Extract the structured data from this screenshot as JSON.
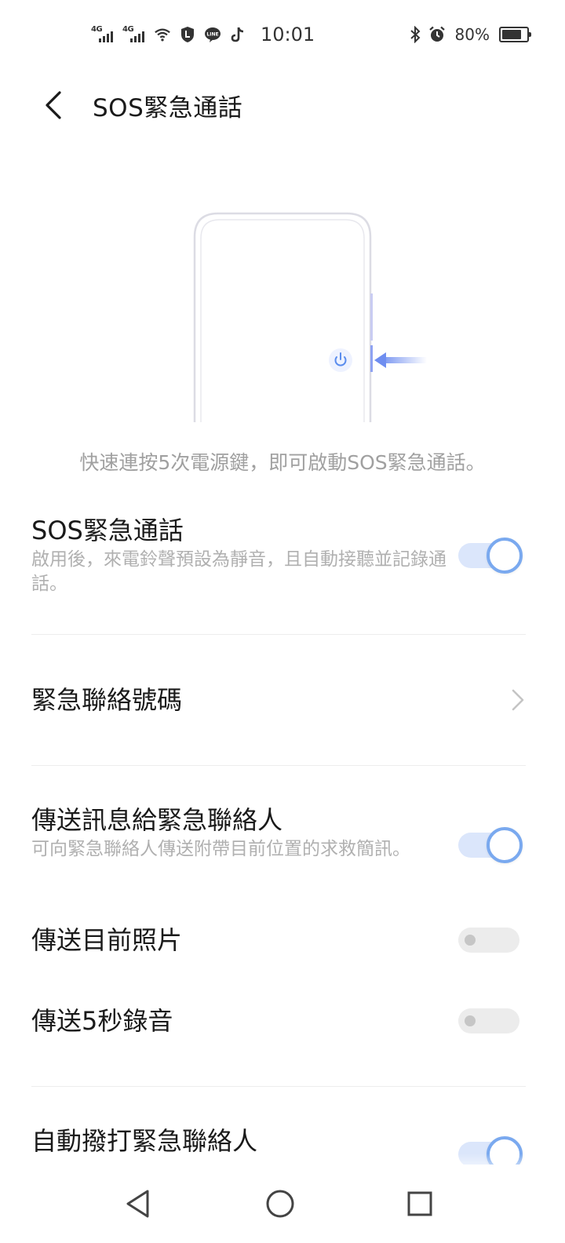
{
  "status_bar": {
    "signal1": "4G",
    "signal2": "4G",
    "time": "10:01",
    "battery_percent": "80%",
    "battery_level": 0.8,
    "icons": [
      "signal-icon",
      "signal-icon",
      "wifi-icon",
      "shield-app-icon",
      "line-app-icon",
      "tiktok-icon",
      "bluetooth-icon",
      "alarm-icon",
      "battery-icon"
    ]
  },
  "header": {
    "title": "SOS緊急通話"
  },
  "illustration": {
    "icons": [
      "phone-outline-icon",
      "power-icon",
      "arrow-left-icon"
    ],
    "accent": "#6f8ef0"
  },
  "hint": "快速連按5次電源鍵，即可啟動SOS緊急通話。",
  "settings": {
    "sos_call": {
      "title": "SOS緊急通話",
      "subtitle": "啟用後，來電鈴聲預設為靜音，且自動接聽並記錄通話。",
      "enabled": true
    },
    "emergency_contacts": {
      "title": "緊急聯絡號碼"
    },
    "send_message": {
      "title": "傳送訊息給緊急聯絡人",
      "subtitle": "可向緊急聯絡人傳送附帶目前位置的求救簡訊。",
      "enabled": true
    },
    "send_photo": {
      "title": "傳送目前照片",
      "enabled": false
    },
    "send_audio": {
      "title": "傳送5秒錄音",
      "enabled": false
    },
    "auto_dial": {
      "title": "自動撥打緊急聯絡人",
      "enabled": true
    }
  },
  "colors": {
    "toggle_on_track": "#dbe6fb",
    "toggle_on_knob_border": "#7aa9ef",
    "toggle_off_track": "#ececec"
  },
  "navbar": {
    "icons": [
      "back-triangle-icon",
      "home-circle-icon",
      "recents-square-icon"
    ]
  }
}
